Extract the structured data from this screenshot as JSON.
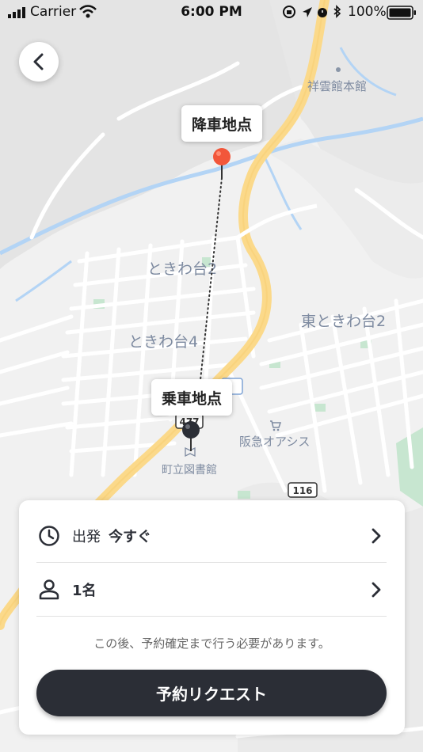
{
  "status_bar": {
    "carrier": "Carrier",
    "time": "6:00 PM",
    "battery": "100%"
  },
  "map": {
    "labels": {
      "shounkan": "祥雲館本館",
      "tokiwadai2": "ときわ台2",
      "tokiwadai4": "ときわ台4",
      "higashi_tokiwadai2": "東ときわ台2",
      "hankyu_oasis": "阪急オアシス",
      "library": "町立図書館",
      "route116": "116",
      "route477": "477"
    },
    "dropoff_label": "降車地点",
    "pickup_label": "乗車地点"
  },
  "sheet": {
    "departure_label": "出発",
    "departure_value": "今すぐ",
    "passengers_value": "1名",
    "note": "この後、予約確定まで行う必要があります。",
    "request_button": "予約リクエスト"
  },
  "colors": {
    "dark": "#2b2e36",
    "road_main": "#fbd98a",
    "water": "#b3d4f5",
    "pin_red": "#f2563a"
  }
}
